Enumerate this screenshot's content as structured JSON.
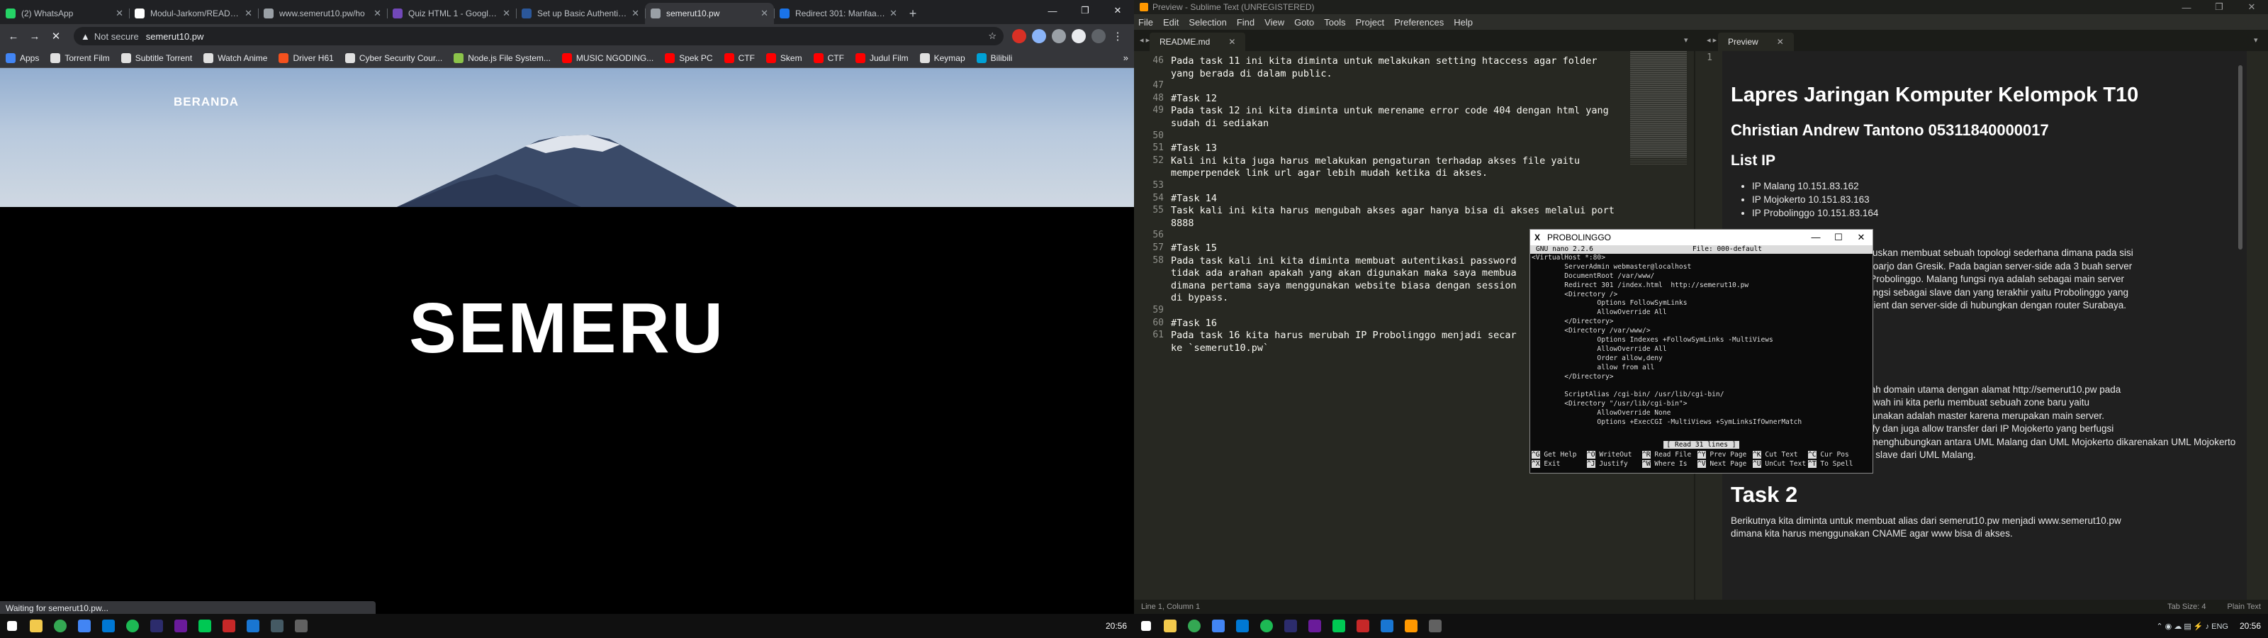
{
  "chrome": {
    "tabs": [
      {
        "label": "(2) WhatsApp",
        "color": "#25d366"
      },
      {
        "label": "Modul-Jarkom/README.m",
        "color": "#ffffff"
      },
      {
        "label": "www.semerut10.pw/ho",
        "color": "#9aa0a6"
      },
      {
        "label": "Quiz HTML 1 - Google F",
        "color": "#7248b9"
      },
      {
        "label": "Set up Basic Authenticati",
        "color": "#2b579a"
      },
      {
        "label": "semerut10.pw",
        "color": "#9aa0a6",
        "active": true
      },
      {
        "label": "Redirect 301: Manfaat d",
        "color": "#1a73e8"
      }
    ],
    "address": {
      "warning": "Not secure",
      "url": "semerut10.pw"
    },
    "bookmarks": [
      {
        "label": "Apps",
        "color": "#4285f4"
      },
      {
        "label": "Torrent Film",
        "color": "#e0e0e0"
      },
      {
        "label": "Subtitle Torrent",
        "color": "#e0e0e0"
      },
      {
        "label": "Watch Anime",
        "color": "#e0e0e0"
      },
      {
        "label": "Driver H61",
        "color": "#f4511e"
      },
      {
        "label": "Cyber Security Cour...",
        "color": "#e0e0e0"
      },
      {
        "label": "Node.js File System...",
        "color": "#8bc34a"
      },
      {
        "label": "MUSIC NGODING...",
        "color": "#ff0000"
      },
      {
        "label": "Spek PC",
        "color": "#ff0000"
      },
      {
        "label": "CTF",
        "color": "#ff0000"
      },
      {
        "label": "Skem",
        "color": "#ff0000"
      },
      {
        "label": "CTF",
        "color": "#ff0000"
      },
      {
        "label": "Judul Film",
        "color": "#ff0000"
      },
      {
        "label": "Keymap",
        "color": "#e0e0e0"
      },
      {
        "label": "Bilibili",
        "color": "#00a1d6"
      }
    ],
    "page": {
      "nav": "BERANDA",
      "title": "SEMERU"
    },
    "status": "Waiting for semerut10.pw..."
  },
  "taskbar_left": {
    "clock": "20:56"
  },
  "taskbar_right": {
    "clock": "20:56"
  },
  "sublime": {
    "title": "Preview - Sublime Text (UNREGISTERED)",
    "menu": [
      "File",
      "Edit",
      "Selection",
      "Find",
      "View",
      "Goto",
      "Tools",
      "Project",
      "Preferences",
      "Help"
    ],
    "tab_left": "README.md",
    "tab_right": "Preview",
    "code": [
      {
        "n": "46",
        "t": "Pada task 11 ini kita diminta untuk melakukan setting htaccess agar folder"
      },
      {
        "n": "",
        "t": "yang berada di dalam public."
      },
      {
        "n": "47",
        "t": ""
      },
      {
        "n": "48",
        "t": "#Task 12",
        "heading": true
      },
      {
        "n": "49",
        "t": "Pada task 12 ini kita diminta untuk merename error code 404 dengan html yang"
      },
      {
        "n": "",
        "t": "sudah di sediakan"
      },
      {
        "n": "50",
        "t": ""
      },
      {
        "n": "51",
        "t": "#Task 13",
        "heading": true
      },
      {
        "n": "52",
        "t": "Kali ini kita juga harus melakukan pengaturan terhadap akses file yaitu"
      },
      {
        "n": "",
        "t": "memperpendek link url agar lebih mudah ketika di akses."
      },
      {
        "n": "53",
        "t": ""
      },
      {
        "n": "54",
        "t": "#Task 14",
        "heading": true
      },
      {
        "n": "55",
        "t": "Task kali ini kita harus mengubah akses agar hanya bisa di akses melalui port"
      },
      {
        "n": "",
        "t": "8888"
      },
      {
        "n": "56",
        "t": ""
      },
      {
        "n": "57",
        "t": "#Task 15",
        "heading": true
      },
      {
        "n": "58",
        "t": "Pada task kali ini kita diminta membuat autentikasi password"
      },
      {
        "n": "",
        "t": "tidak ada arahan apakah yang akan digunakan maka saya membua"
      },
      {
        "n": "",
        "t": "dimana pertama saya menggunakan website biasa dengan session"
      },
      {
        "n": "",
        "t": "di bypass."
      },
      {
        "n": "59",
        "t": ""
      },
      {
        "n": "60",
        "t": "#Task 16",
        "heading": true
      },
      {
        "n": "61",
        "t": "Pada task 16 kita harus merubah IP Probolinggo menjadi secar"
      },
      {
        "n": "",
        "t": "ke `semerut10.pw`"
      }
    ],
    "preview": {
      "h1": "Lapres Jaringan Komputer Kelompok T10",
      "h2": "Christian Andrew Tantono 05311840000017",
      "h3": "List IP",
      "ips": [
        "IP Malang 10.151.83.162",
        "IP Mojokerto 10.151.83.163",
        "IP Probolinggo 10.151.83.164"
      ],
      "para1": [
        "diharuskan membuat sebuah topologi sederhana dimana pada sisi",
        "u Sidoarjo dan Gresik. Pada bagian server-side ada 3 buah server",
        "dan Probolinggo. Malang fungsi nya adalah sebagai main server",
        "berfungsi sebagai slave dan yang terakhir yaitu Probolinggo yang",
        "er. Client dan server-side di hubungkan dengan router Surabaya."
      ],
      "para2": [
        "t sebuah domain utama dengan alamat http://semerut10.pw pada",
        "ar dibawah ini kita perlu membuat sebuah zone baru yaitu",
        "ing digunakan adalah master karena merupakan main server.",
        "so notify dan juga allow transfer dari IP Mojokerto yang berfugsi",
        "untuk menghubungkan antara UML Malang dan UML Mojokerto dikarenakan UML Mojokerto",
        "adalah slave dari UML Malang."
      ],
      "task2": "Task 2",
      "para3": [
        "Berikutnya kita diminta untuk membuat alias dari semerut10.pw menjadi www.semerut10.pw",
        "dimana kita harus menggunakan CNAME agar www bisa di akses."
      ]
    },
    "status_left": "Line 1, Column 1",
    "status_tab": "Tab Size: 4",
    "status_syntax": "Plain Text"
  },
  "nano": {
    "title": "PROBOLINGGO",
    "version": "GNU nano 2.2.6",
    "file": "File: 000-default",
    "lines": [
      "<VirtualHost *:80>",
      "        ServerAdmin webmaster@localhost",
      "        DocumentRoot /var/www/",
      "        Redirect 301 /index.html  http://semerut10.pw",
      "        <Directory />",
      "                Options FollowSymLinks",
      "                AllowOverride All",
      "        </Directory>",
      "        <Directory /var/www/>",
      "                Options Indexes +FollowSymLinks -MultiViews",
      "                AllowOverride All",
      "                Order allow,deny",
      "                allow from all",
      "        </Directory>",
      "",
      "        ScriptAlias /cgi-bin/ /usr/lib/cgi-bin/",
      "        <Directory \"/usr/lib/cgi-bin\">",
      "                AllowOverride None",
      "                Options +ExecCGI -MultiViews +SymLinksIfOwnerMatch"
    ],
    "status": "[ Read 31 lines ]",
    "keys_row1": [
      [
        "^G",
        "Get Help"
      ],
      [
        "^O",
        "WriteOut"
      ],
      [
        "^R",
        "Read File"
      ],
      [
        "^Y",
        "Prev Page"
      ],
      [
        "^K",
        "Cut Text"
      ],
      [
        "^C",
        "Cur Pos"
      ]
    ],
    "keys_row2": [
      [
        "^X",
        "Exit"
      ],
      [
        "^J",
        "Justify"
      ],
      [
        "^W",
        "Where Is"
      ],
      [
        "^V",
        "Next Page"
      ],
      [
        "^U",
        "UnCut Text"
      ],
      [
        "^T",
        "To Spell"
      ]
    ]
  }
}
